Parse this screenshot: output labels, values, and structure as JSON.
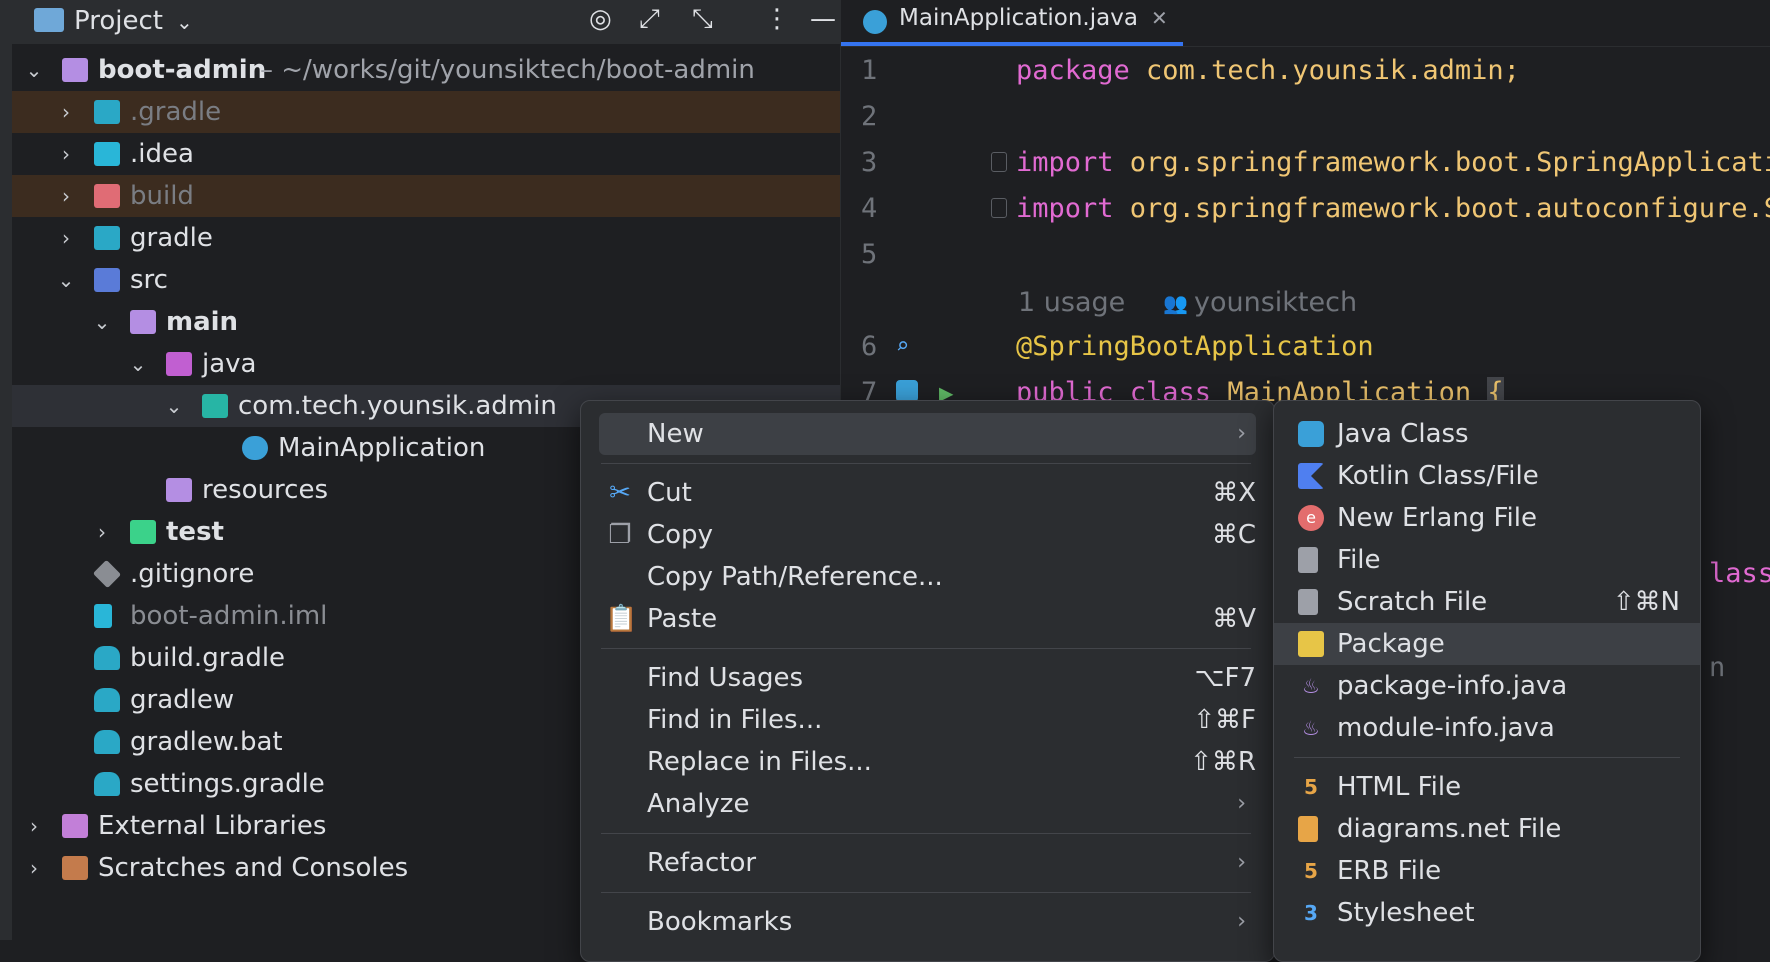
{
  "project": {
    "title": "Project",
    "tree": [
      {
        "label": "boot-admin",
        "suffix": " – ~/works/git/younsiktech/boot-admin"
      },
      {
        "label": ".gradle"
      },
      {
        "label": ".idea"
      },
      {
        "label": "build"
      },
      {
        "label": "gradle"
      },
      {
        "label": "src"
      },
      {
        "label": "main"
      },
      {
        "label": "java"
      },
      {
        "label": "com.tech.younsik.admin"
      },
      {
        "label": "MainApplication"
      },
      {
        "label": "resources"
      },
      {
        "label": "test"
      },
      {
        "label": ".gitignore"
      },
      {
        "label": "boot-admin.iml"
      },
      {
        "label": "build.gradle"
      },
      {
        "label": "gradlew"
      },
      {
        "label": "gradlew.bat"
      },
      {
        "label": "settings.gradle"
      },
      {
        "label": "External Libraries"
      },
      {
        "label": "Scratches and Consoles"
      }
    ]
  },
  "editor": {
    "tab": "MainApplication.java",
    "lines": [
      {
        "n": "1",
        "kw": "package",
        "rest": " com.tech.younsik.admin;"
      },
      {
        "n": "2",
        "kw": "",
        "rest": ""
      },
      {
        "n": "3",
        "kw": "import",
        "rest": " org.springframework.boot.SpringApplicati"
      },
      {
        "n": "4",
        "kw": "import",
        "rest": " org.springframework.boot.autoconfigure.S"
      },
      {
        "n": "5",
        "kw": "",
        "rest": ""
      }
    ],
    "usage_hint": "1 usage",
    "author": "younsiktech",
    "annotation_line_no": "6",
    "annotation": "@SpringBootApplication",
    "class_line_no": "7",
    "class_kw": "public class",
    "class_name": " MainApplication ",
    "brace": "{",
    "peek_class": "lass",
    "peek_n": "n"
  },
  "context_menu": {
    "new": "New",
    "cut": "Cut",
    "cut_sc": "⌘X",
    "copy": "Copy",
    "copy_sc": "⌘C",
    "copy_path": "Copy Path/Reference...",
    "paste": "Paste",
    "paste_sc": "⌘V",
    "find_usages": "Find Usages",
    "find_usages_sc": "⌥F7",
    "find_in_files": "Find in Files...",
    "find_in_files_sc": "⇧⌘F",
    "replace_in_files": "Replace in Files...",
    "replace_in_files_sc": "⇧⌘R",
    "analyze": "Analyze",
    "refactor": "Refactor",
    "bookmarks": "Bookmarks"
  },
  "submenu": {
    "java_class": "Java Class",
    "kotlin": "Kotlin Class/File",
    "erlang": "New Erlang File",
    "file": "File",
    "scratch": "Scratch File",
    "scratch_sc": "⇧⌘N",
    "package": "Package",
    "package_info": "package-info.java",
    "module_info": "module-info.java",
    "html": "HTML File",
    "diagrams": "diagrams.net File",
    "erb": "ERB File",
    "stylesheet": "Stylesheet"
  },
  "colors": {
    "accent": "#3574f0",
    "selection": "#3d4045",
    "excluded": "#3c2c1f"
  }
}
